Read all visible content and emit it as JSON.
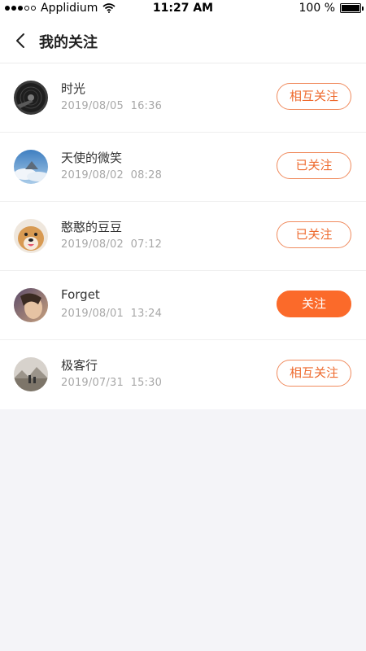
{
  "status_bar": {
    "carrier": "Applidium",
    "time": "11:27 AM",
    "battery": "100 %"
  },
  "header": {
    "title": "我的关注"
  },
  "follows": [
    {
      "name": "时光",
      "time": "2019/08/05  16:36",
      "button": "相互关注",
      "avatar": "vinyl-record-avatar"
    },
    {
      "name": "天使的微笑",
      "time": "2019/08/02  08:28",
      "button": "已关注",
      "avatar": "sky-clouds-avatar"
    },
    {
      "name": "憨憨的豆豆",
      "time": "2019/08/02  07:12",
      "button": "已关注",
      "avatar": "dog-avatar"
    },
    {
      "name": "Forget",
      "time": "2019/08/01  13:24",
      "button": "关注",
      "avatar": "portrait-avatar"
    },
    {
      "name": "极客行",
      "time": "2019/07/31  15:30",
      "button": "相互关注",
      "avatar": "landscape-avatar"
    }
  ],
  "colors": {
    "accent": "#fb6a2a",
    "outline": "#f08b5e",
    "background": "#f4f4f8"
  }
}
